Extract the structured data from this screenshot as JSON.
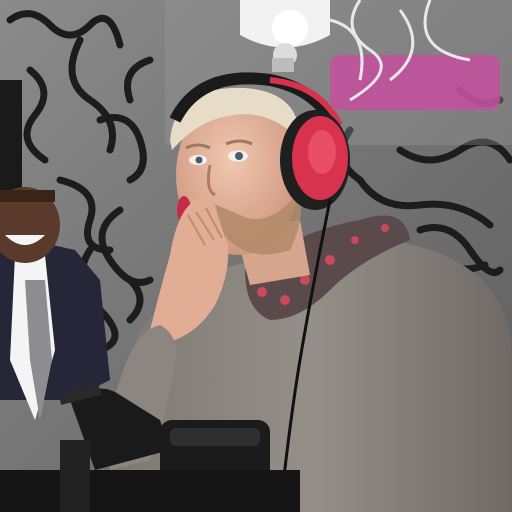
{
  "image": {
    "subject": "streamer-webcam-frame",
    "colors": {
      "wall": "#7b7b7b",
      "graffiti": "#1c1c1c",
      "magenta": "#c64fa0",
      "headphones": "#d8324d",
      "hoodie": "#8b847f",
      "skin": "#e3b39c",
      "hair": "#e7dcc7",
      "mic": "#1a1a1a",
      "suit": "#252637"
    }
  }
}
